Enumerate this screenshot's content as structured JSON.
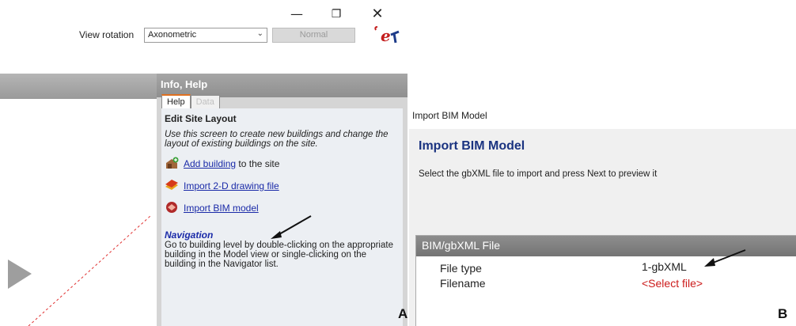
{
  "window_controls": {
    "minimize": "—",
    "maximize": "❐",
    "close": "✕"
  },
  "toolbar": {
    "view_rotation_label": "View rotation",
    "view_rotation_value": "Axonometric",
    "normal_button": "Normal"
  },
  "info_panel": {
    "header": "Info, Help",
    "tabs": [
      {
        "label": "Help"
      },
      {
        "label": "Data"
      }
    ],
    "title": "Edit Site Layout",
    "description": "Use this screen to create new buildings and change the layout of existing buildings on the site.",
    "actions": [
      {
        "icon": "add-building-icon",
        "link": "Add building",
        "suffix": " to the site"
      },
      {
        "icon": "import-drawing-icon",
        "link": "Import 2-D drawing file",
        "suffix": ""
      },
      {
        "icon": "import-bim-icon",
        "link": "Import BIM model",
        "suffix": ""
      }
    ],
    "navigation_title": "Navigation",
    "navigation_text": "Go to building level by double-clicking on the appropriate building in the Model view or single-clicking on the building in the Navigator list."
  },
  "panel_label_A": "A",
  "import_dialog": {
    "window_title": "Import BIM Model",
    "heading": "Import BIM Model",
    "instruction": "Select the gbXML file to import and press Next to preview it",
    "section_title": "BIM/gbXML File",
    "rows": [
      {
        "label": "File type",
        "value": "1-gbXML"
      },
      {
        "label": "Filename",
        "value": "<Select file>"
      }
    ]
  },
  "panel_label_B": "B",
  "colors": {
    "link": "#1a2aa8",
    "heading": "#1a3380",
    "select_file": "#cc1b1b",
    "tab_accent": "#e07020"
  }
}
